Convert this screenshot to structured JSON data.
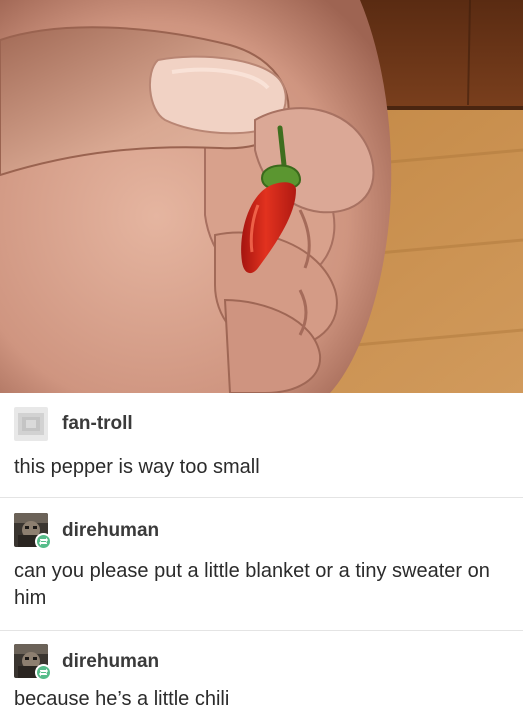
{
  "photo": {
    "subject": "fingers-holding-tiny-red-chili-pepper",
    "colors": {
      "skin": "#d9a48c",
      "pepper": "#d8271d",
      "stem": "#4f8b2c",
      "floor": "#c58a45"
    }
  },
  "posts": [
    {
      "username": "fan-troll",
      "text": "this pepper is way too small",
      "avatar": "blurred-avatar",
      "reblog": false
    },
    {
      "username": "direhuman",
      "text": "can you please put a little blanket or a tiny sweater on him",
      "avatar": "dark-avatar",
      "reblog": true
    },
    {
      "username": "direhuman",
      "text": "because he’s a little chili",
      "avatar": "dark-avatar",
      "reblog": true
    }
  ],
  "colors": {
    "reblog_badge": "#56bc8a",
    "divider": "#e4e4e4",
    "text": "#2b2b2b"
  }
}
